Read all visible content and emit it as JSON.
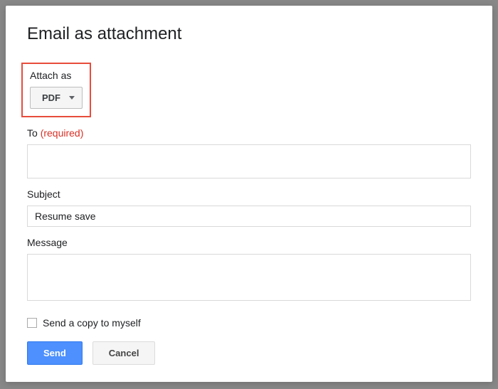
{
  "dialog": {
    "title": "Email as attachment",
    "attach": {
      "label": "Attach as",
      "selected": "PDF"
    },
    "to": {
      "label": "To",
      "required_text": "(required)",
      "value": ""
    },
    "subject": {
      "label": "Subject",
      "value": "Resume save"
    },
    "message": {
      "label": "Message",
      "value": ""
    },
    "copy_checkbox": {
      "label": "Send a copy to myself",
      "checked": false
    },
    "buttons": {
      "send": "Send",
      "cancel": "Cancel"
    }
  }
}
